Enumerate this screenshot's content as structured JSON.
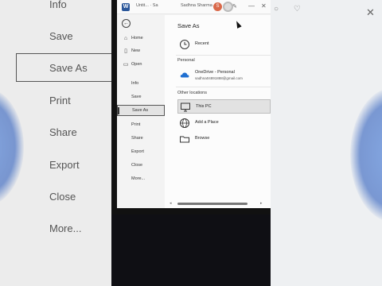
{
  "background": {
    "menu": [
      "Info",
      "Save",
      "Save As",
      "Print",
      "Share",
      "Export",
      "Close",
      "More..."
    ],
    "accent": "#2f6fd8"
  },
  "window": {
    "doc_name": "Untit... · Sa",
    "user_name": "Sadhna Sharma",
    "avatar_initial": "S",
    "accent": "#2b579a"
  },
  "nav": {
    "back_label": "←",
    "items": [
      {
        "label": "Home",
        "icon": "home-icon"
      },
      {
        "label": "New",
        "icon": "new-document-icon"
      },
      {
        "label": "Open",
        "icon": "folder-open-icon"
      },
      {
        "label": "Info"
      },
      {
        "label": "Save"
      },
      {
        "label": "Save As"
      },
      {
        "label": "Print"
      },
      {
        "label": "Share"
      },
      {
        "label": "Export"
      },
      {
        "label": "Close"
      },
      {
        "label": "More..."
      }
    ]
  },
  "content": {
    "title": "Save As",
    "recent_label": "Recent",
    "personal_heading": "Personal",
    "onedrive_label": "OneDrive - Personal",
    "onedrive_email": "sadhna04891888@gmail.com",
    "other_heading": "Other locations",
    "this_pc_label": "This PC",
    "add_place_label": "Add a Place",
    "browse_label": "Browse"
  }
}
